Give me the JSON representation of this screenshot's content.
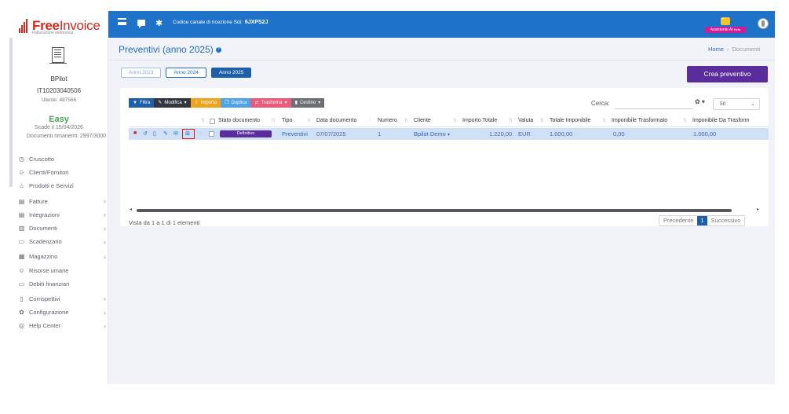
{
  "brand": {
    "name_bold": "Free",
    "name_thin": "Invoice",
    "tagline": "Fatturazione elettronica"
  },
  "topbar": {
    "sdi_label": "Codice canale di ricezione Sdi:",
    "sdi_code": "6JXPS2J",
    "assistant_label": "Assistente AI",
    "assistant_tag": "Beta",
    "color": "#1e72c8"
  },
  "account": {
    "name": "BPilot",
    "vat": "IT10203040506",
    "user_id": "Utente: 487566",
    "plan": "Easy",
    "expiry": "Scade il 15/04/2026",
    "docs_remaining": "Documenti rimanenti: 2997/3000"
  },
  "sidebar": {
    "items": [
      {
        "label": "Cruscotto",
        "icon": "dashboard-icon",
        "glyph": "◷",
        "has_submenu": false
      },
      {
        "label": "Clienti/Fornitori",
        "icon": "person-icon",
        "glyph": "☺",
        "has_submenu": false
      },
      {
        "label": "Prodotti e Servizi",
        "icon": "basket-icon",
        "glyph": "⌂",
        "has_submenu": false
      },
      {
        "label": "Fatture",
        "icon": "file-icon",
        "glyph": "▤",
        "has_submenu": true
      },
      {
        "label": "Integrazioni",
        "icon": "file-icon",
        "glyph": "▤",
        "has_submenu": true
      },
      {
        "label": "Documenti",
        "icon": "files-icon",
        "glyph": "▥",
        "has_submenu": true
      },
      {
        "label": "Scadenzario",
        "icon": "money-icon",
        "glyph": "▭",
        "has_submenu": true
      },
      {
        "label": "Magazzino",
        "icon": "warehouse-icon",
        "glyph": "▦",
        "has_submenu": true
      },
      {
        "label": "Risorse umane",
        "icon": "person-icon",
        "glyph": "☺",
        "has_submenu": false
      },
      {
        "label": "Debiti finanziari",
        "icon": "money-icon",
        "glyph": "▭",
        "has_submenu": false
      },
      {
        "label": "Corrispettivi",
        "icon": "receipt-icon",
        "glyph": "▯",
        "has_submenu": true
      },
      {
        "label": "Configurazione",
        "icon": "gear-icon",
        "glyph": "✿",
        "has_submenu": true
      },
      {
        "label": "Help Center",
        "icon": "lifebuoy-icon",
        "glyph": "◎",
        "has_submenu": true
      }
    ]
  },
  "header": {
    "title": "Preventivi (anno 2025)",
    "breadcrumb_home": "Home",
    "breadcrumb_current": "Documenti"
  },
  "year_tabs": [
    "Anno 2023",
    "Anno 2024",
    "Anno 2025"
  ],
  "active_year": "Anno 2025",
  "create_button": "Crea preventivo",
  "toolbar": {
    "filtra": "Filtra",
    "modifica": "Modifica",
    "importa": "Importa",
    "duplica": "Duplica",
    "trasforma": "Trasforma",
    "cestino": "Cestino"
  },
  "search": {
    "label": "Cerca:",
    "value": ""
  },
  "page_size": "50",
  "table": {
    "columns": [
      "Stato documento",
      "Tipo",
      "Data documento",
      "Numero",
      "Cliente",
      "Importo Totale",
      "Valuta",
      "Totale Imponibile",
      "Imponibile Trasformato",
      "Imponibile Da Trasform"
    ],
    "rows": [
      {
        "stato": "Definitivo",
        "tipo": "Preventivi",
        "data": "07/07/2025",
        "numero": "1",
        "cliente": "Bpilot Demo",
        "importo_totale": "1.220,00",
        "valuta": "EUR",
        "totale_imponibile": "1.000,00",
        "imponibile_trasformato": "0,00",
        "imponibile_da_trasformare": "1.000,00"
      }
    ]
  },
  "footer": {
    "summary": "Vista da 1 a 1 di 1 elementi",
    "prev": "Precedente",
    "current_page": "1",
    "next": "Successivo"
  },
  "colors": {
    "primary": "#1e6dbd",
    "brand_red": "#d6281f",
    "purple": "#5b2d9c",
    "plan_green": "#4aa35a",
    "selected_row": "#cfe0f7"
  }
}
